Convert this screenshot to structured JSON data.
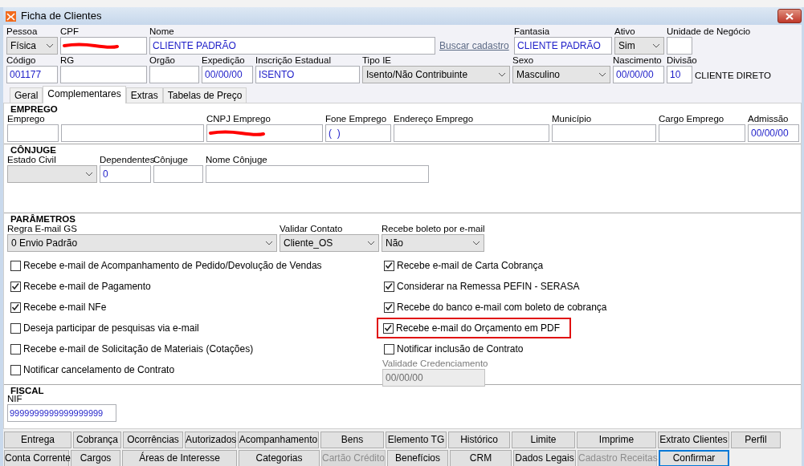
{
  "window": {
    "title": "Ficha de Clientes"
  },
  "header_rows": [
    [
      {
        "label": "Pessoa",
        "kind": "select",
        "value": "Física"
      },
      {
        "label": "CPF",
        "kind": "input",
        "redacted": true
      },
      {
        "label": "Nome",
        "kind": "input",
        "value": "CLIENTE PADRÃO"
      },
      {
        "kind": "link",
        "text": "Buscar cadastro"
      },
      {
        "label": "Fantasia",
        "kind": "input",
        "value": "CLIENTE PADRÃO"
      },
      {
        "label": "Ativo",
        "kind": "select",
        "value": "Sim"
      },
      {
        "label": "Unidade de Negócio",
        "kind": "input"
      }
    ],
    [
      {
        "label": "Código",
        "kind": "input",
        "value": "001177"
      },
      {
        "label": "RG",
        "kind": "input"
      },
      {
        "label": "Orgão",
        "kind": "input"
      },
      {
        "label": "Expedição",
        "kind": "input",
        "value": "00/00/00"
      },
      {
        "label": "Inscrição Estadual",
        "kind": "input",
        "value": "ISENTO"
      },
      {
        "label": "Tipo IE",
        "kind": "select",
        "value": "Isento/Não Contribuinte"
      },
      {
        "label": "Sexo",
        "kind": "select",
        "value": "Masculino"
      },
      {
        "label": "Nascimento",
        "kind": "input",
        "value": "00/00/00"
      },
      {
        "label": "Divisão",
        "kind": "input",
        "value": "10"
      },
      {
        "kind": "note",
        "text": "CLIENTE DIRETO"
      }
    ]
  ],
  "tabs": [
    {
      "label": "Geral",
      "selected": false
    },
    {
      "label": "Complementares",
      "selected": true
    },
    {
      "label": "Extras",
      "selected": false
    },
    {
      "label": "Tabelas de Preço",
      "selected": false
    }
  ],
  "sections": [
    {
      "title": "EMPREGO",
      "fields": [
        {
          "label": "Emprego",
          "kind": "input"
        },
        {
          "kind": "input"
        },
        {
          "label": "CNPJ Emprego",
          "kind": "input",
          "redacted": true
        },
        {
          "label": "Fone Emprego",
          "kind": "input",
          "value": "(  )"
        },
        {
          "label": "Endereço Emprego",
          "kind": "input"
        },
        {
          "label": "Município",
          "kind": "input"
        },
        {
          "label": "Cargo Emprego",
          "kind": "input"
        },
        {
          "label": "Admissão",
          "kind": "input",
          "value": "00/00/00"
        }
      ]
    },
    {
      "title": "CÔNJUGE",
      "fields": [
        {
          "label": "Estado Civil",
          "kind": "select"
        },
        {
          "label": "Dependentes",
          "kind": "input",
          "value": "0"
        },
        {
          "label": "Cônjuge",
          "kind": "input"
        },
        {
          "label": "Nome Cônjuge",
          "kind": "input"
        }
      ]
    },
    {
      "title": "PARÂMETROS",
      "fields": [
        {
          "label": "Regra E-mail GS",
          "kind": "select",
          "value": "0 Envio Padrão"
        },
        {
          "label": "Validar Contato",
          "kind": "select",
          "value": "Cliente_OS"
        },
        {
          "label": "Recebe boleto por e-mail",
          "kind": "select",
          "value": "Não"
        }
      ],
      "checkboxes_left": [
        {
          "label": "Recebe e-mail de Acompanhamento de Pedido/Devolução de Vendas",
          "checked": false,
          "highlighted": false
        },
        {
          "label": "Recebe e-mail de Pagamento",
          "checked": true,
          "highlighted": false
        },
        {
          "label": "Recebe e-mail NFe",
          "checked": true,
          "highlighted": false
        },
        {
          "label": "Deseja participar de pesquisas via e-mail",
          "checked": false,
          "highlighted": false
        },
        {
          "label": "Recebe e-mail de Solicitação de Materiais (Cotações)",
          "checked": false,
          "highlighted": false
        },
        {
          "label": "Notificar cancelamento de Contrato",
          "checked": false,
          "highlighted": false
        }
      ],
      "checkboxes_right": [
        {
          "label": "Recebe e-mail de Carta Cobrança",
          "checked": true,
          "highlighted": false
        },
        {
          "label": "Considerar na Remessa PEFIN - SERASA",
          "checked": true,
          "highlighted": false
        },
        {
          "label": "Recebe do banco e-mail com boleto de cobrança",
          "checked": true,
          "highlighted": false
        },
        {
          "label": "Recebe e-mail do Orçamento em PDF",
          "checked": true,
          "highlighted": true
        },
        {
          "label": "Notificar inclusão de Contrato",
          "checked": false,
          "highlighted": false
        }
      ],
      "extra_field": {
        "label": "Validade Credenciamento",
        "kind": "input",
        "value": "00/00/00",
        "disabled": true
      }
    },
    {
      "title": "FISCAL",
      "fields": [
        {
          "label": "NIF",
          "kind": "input",
          "value": "9999999999999999999"
        }
      ]
    }
  ],
  "button_rows": [
    [
      {
        "label": "Entrega",
        "disabled": false,
        "focused": false
      },
      {
        "label": "Cobrança",
        "disabled": false,
        "focused": false
      },
      {
        "label": "Ocorrências",
        "disabled": false,
        "focused": false
      },
      {
        "label": "Autorizados",
        "disabled": false,
        "focused": false
      },
      {
        "label": "Acompanhamento",
        "disabled": false,
        "focused": false
      },
      {
        "label": "Bens",
        "disabled": false,
        "focused": false
      },
      {
        "label": "Elemento TG",
        "disabled": false,
        "focused": false
      },
      {
        "label": "Histórico",
        "disabled": false,
        "focused": false
      },
      {
        "label": "Limite",
        "disabled": false,
        "focused": false
      },
      {
        "label": "Imprime",
        "disabled": false,
        "focused": false
      },
      {
        "label": "Extrato Clientes",
        "disabled": false,
        "focused": false
      },
      {
        "label": "Perfil",
        "disabled": false,
        "focused": false
      }
    ],
    [
      {
        "label": "Conta Corrente",
        "disabled": false,
        "focused": false
      },
      {
        "label": "Cargos",
        "disabled": false,
        "focused": false
      },
      {
        "label": "Áreas de Interesse",
        "disabled": false,
        "focused": false
      },
      {
        "label": "Categorias",
        "disabled": false,
        "focused": false
      },
      {
        "label": "Cartão Crédito",
        "disabled": true,
        "focused": false
      },
      {
        "label": "Benefícios",
        "disabled": false,
        "focused": false
      },
      {
        "label": "CRM",
        "disabled": false,
        "focused": false
      },
      {
        "label": "Dados Legais",
        "disabled": false,
        "focused": false
      },
      {
        "label": "Cadastro Receitas",
        "disabled": true,
        "focused": false
      },
      {
        "label": "Confirmar",
        "disabled": false,
        "focused": true
      }
    ]
  ]
}
